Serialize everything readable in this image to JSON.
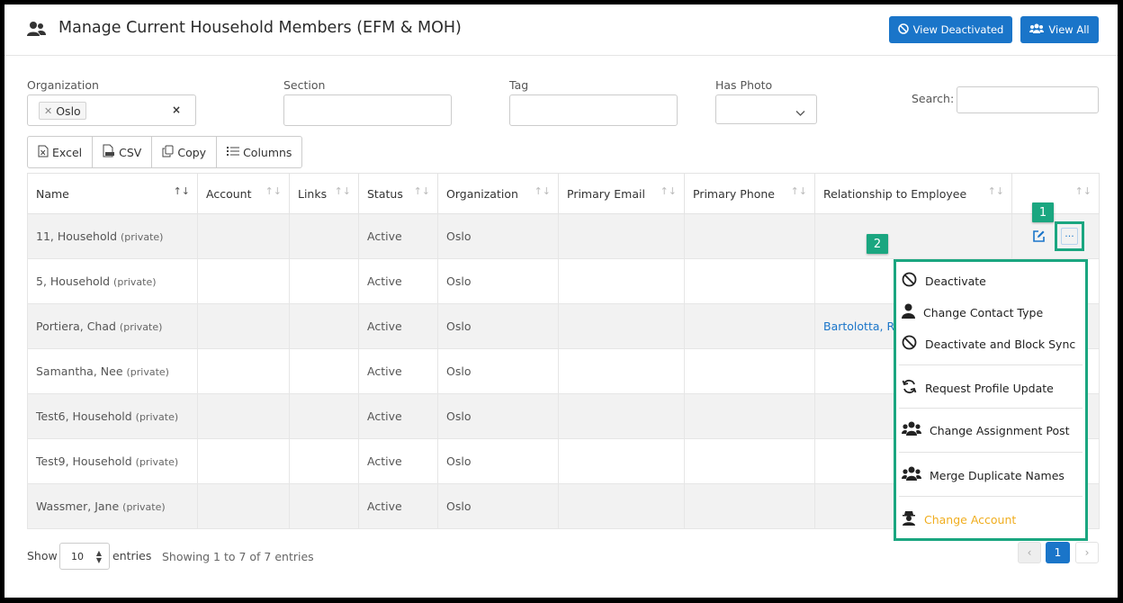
{
  "header": {
    "title": "Manage Current Household Members (EFM & MOH)",
    "buttons": {
      "view_deactivated": "View Deactivated",
      "view_all": "View All"
    }
  },
  "filters": {
    "organization": {
      "label": "Organization",
      "chip": "Oslo",
      "clear": "×"
    },
    "section": {
      "label": "Section",
      "value": ""
    },
    "tag": {
      "label": "Tag",
      "value": ""
    },
    "has_photo": {
      "label": "Has Photo",
      "value": ""
    },
    "search": {
      "label": "Search:",
      "value": ""
    }
  },
  "toolbar": {
    "excel": "Excel",
    "csv": "CSV",
    "copy": "Copy",
    "columns": "Columns"
  },
  "table": {
    "columns": [
      "Name",
      "Account",
      "Links",
      "Status",
      "Organization",
      "Primary Email",
      "Primary Phone",
      "Relationship to Employee",
      ""
    ],
    "rows": [
      {
        "name": "11, Household",
        "private": "(private)",
        "status": "Active",
        "org": "Oslo",
        "relationship": ""
      },
      {
        "name": "5, Household",
        "private": "(private)",
        "status": "Active",
        "org": "Oslo",
        "relationship": ""
      },
      {
        "name": "Portiera, Chad",
        "private": "(private)",
        "status": "Active",
        "org": "Oslo",
        "relationship": "Bartolotta, R"
      },
      {
        "name": "Samantha, Nee",
        "private": "(private)",
        "status": "Active",
        "org": "Oslo",
        "relationship": ""
      },
      {
        "name": "Test6, Household",
        "private": "(private)",
        "status": "Active",
        "org": "Oslo",
        "relationship": ""
      },
      {
        "name": "Test9, Household",
        "private": "(private)",
        "status": "Active",
        "org": "Oslo",
        "relationship": ""
      },
      {
        "name": "Wassmer, Jane",
        "private": "(private)",
        "status": "Active",
        "org": "Oslo",
        "relationship": ""
      }
    ]
  },
  "callouts": {
    "one": "1",
    "two": "2",
    "more": "···"
  },
  "menu": {
    "deactivate": "Deactivate",
    "change_contact_type": "Change Contact Type",
    "deactivate_block_sync": "Deactivate and Block Sync",
    "request_profile_update": "Request Profile Update",
    "change_assignment_post": "Change Assignment Post",
    "merge_duplicate_names": "Merge Duplicate Names",
    "change_account": "Change Account"
  },
  "footer": {
    "show": "Show",
    "entries_value": "10",
    "entries": "entries",
    "info": "Showing 1 to 7 of 7 entries",
    "page": "1"
  },
  "colors": {
    "accent": "#1a75c9",
    "callout": "#1aa680",
    "warning": "#f0ad1e"
  }
}
